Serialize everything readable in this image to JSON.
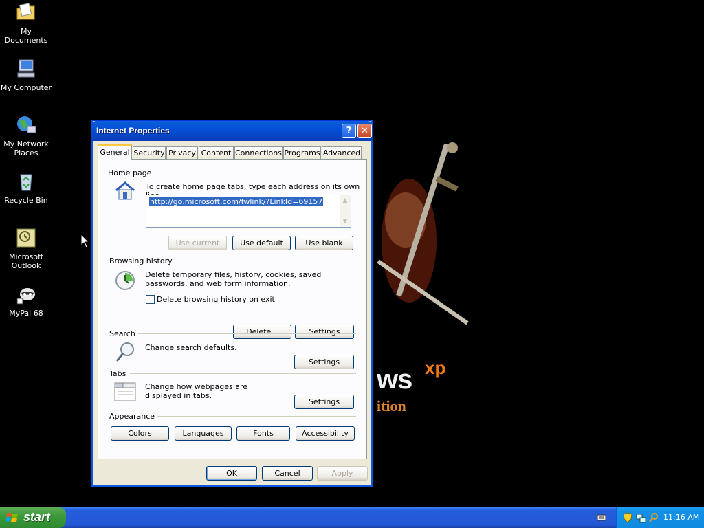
{
  "desktop": {
    "icons": [
      {
        "label": "My Documents"
      },
      {
        "label": "My Computer"
      },
      {
        "label": "My Network Places"
      },
      {
        "label": "Recycle Bin"
      },
      {
        "label": "Microsoft Outlook"
      },
      {
        "label": "MyPal 68"
      }
    ]
  },
  "dialog": {
    "title": "Internet Properties",
    "help_symbol": "?",
    "close_symbol": "✕",
    "tabs": [
      "General",
      "Security",
      "Privacy",
      "Content",
      "Connections",
      "Programs",
      "Advanced"
    ],
    "active_tab": "General",
    "home_page": {
      "heading": "Home page",
      "description": "To create home page tabs, type each address on its own line.",
      "url": "http://go.microsoft.com/fwlink/?LinkId=69157",
      "use_current": "Use current",
      "use_default": "Use default",
      "use_blank": "Use blank"
    },
    "browsing_history": {
      "heading": "Browsing history",
      "description": "Delete temporary files, history, cookies, saved passwords, and web form information.",
      "checkbox_label": "Delete browsing history on exit",
      "checkbox_checked": false,
      "delete_button": "Delete...",
      "settings_button": "Settings"
    },
    "search": {
      "heading": "Search",
      "description": "Change search defaults.",
      "settings_button": "Settings"
    },
    "tabs_section": {
      "heading": "Tabs",
      "description": "Change how webpages are displayed in tabs.",
      "settings_button": "Settings"
    },
    "appearance": {
      "heading": "Appearance",
      "colors": "Colors",
      "languages": "Languages",
      "fonts": "Fonts",
      "accessibility": "Accessibility"
    },
    "footer": {
      "ok": "OK",
      "cancel": "Cancel",
      "apply": "Apply"
    }
  },
  "taskbar": {
    "start_label": "start",
    "clock": "11:16 AM"
  },
  "colors": {
    "title_bar": "#0a5fd8",
    "selection": "#316ac5",
    "start_button": "#3c9a3c",
    "taskbar": "#245edb"
  }
}
